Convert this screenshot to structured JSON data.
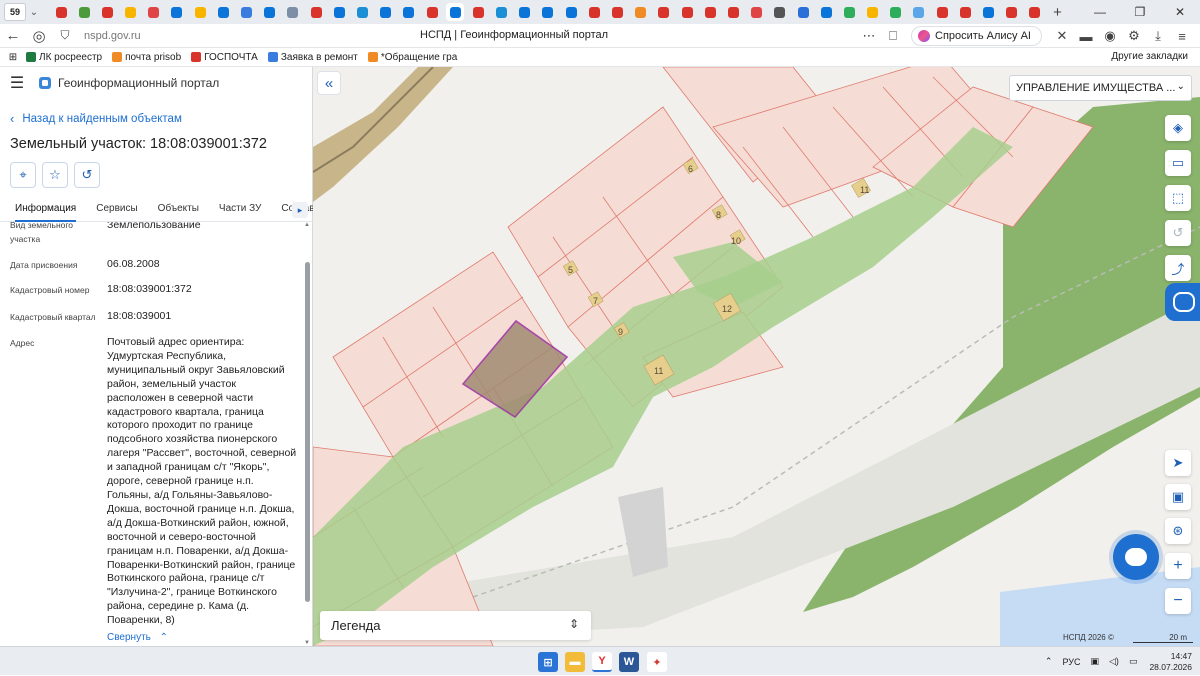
{
  "browser": {
    "tab_count": "59",
    "url": "nspd.gov.ru",
    "title": "НСПД | Геоинформационный портал",
    "alice_button": "Спросить Алису AI",
    "favicon_colors": [
      "#d9342b",
      "#4b9b3b",
      "#d9342b",
      "#f7b500",
      "#e04545",
      "#0a74d8",
      "#f7b500",
      "#0a74d8",
      "#3a7be0",
      "#0a74d8",
      "#7d8ea7",
      "#d9342b",
      "#0a74d8",
      "#1b8fd6",
      "#0a74d8",
      "#0a74d8",
      "#d9342b",
      "#0a74d8",
      "#d9342b",
      "#1b8fd6",
      "#0a74d8",
      "#0a74d8",
      "#0a74d8",
      "#d9342b",
      "#d9342b",
      "#f08a24",
      "#d9342b",
      "#d9342b",
      "#d9342b",
      "#d9342b",
      "#e04545",
      "#555555",
      "#2b6fd8",
      "#0a74d8",
      "#2eae5a",
      "#f7b500",
      "#2eae5a",
      "#5aa6e8",
      "#d9342b",
      "#d9342b",
      "#0a74d8",
      "#d9342b",
      "#d9342b"
    ],
    "bookmarks": [
      {
        "label": "ЛК росреестр",
        "color": "#1f7a3f"
      },
      {
        "label": "почта prisob",
        "color": "#f08a24"
      },
      {
        "label": "ГОСПОЧТА",
        "color": "#d9342b"
      },
      {
        "label": "Заявка в ремонт",
        "color": "#3a7be0"
      },
      {
        "label": "*Обращение гра",
        "color": "#f08a24"
      }
    ],
    "other_bookmarks": "Другие закладки"
  },
  "panel": {
    "portal_name": "Геоинформационный портал",
    "back_link": "Назад к найденным объектам",
    "object_title": "Земельный участок: 18:08:039001:372",
    "tabs": [
      "Информация",
      "Сервисы",
      "Объекты",
      "Части ЗУ",
      "Состав"
    ],
    "collapse_link": "Свернуть",
    "rows": [
      {
        "label": "Вид земельного участка",
        "value": "Землепользование"
      },
      {
        "label": "Дата присвоения",
        "value": "06.08.2008"
      },
      {
        "label": "Кадастровый номер",
        "value": "18:08:039001:372"
      },
      {
        "label": "Кадастровый квартал",
        "value": "18:08:039001"
      },
      {
        "label": "Адрес",
        "value": "Почтовый адрес ориентира: Удмуртская Республика, муниципальный округ Завьяловский район, земельный участок расположен в северной части кадастрового квартала, граница которого проходит по границе подсобного хозяйства пионерского лагеря \"Рассвет\", восточной, северной и западной границам с/т \"Якорь\", дороге, северной границе н.п. Гольяны, а/д Гольяны-Завьялово-Докша, восточной границе н.п. Докша, а/д Докша-Воткинский район, южной, восточной и северо-восточной границам н.п. Поваренки, а/д Докша-Поваренки-Воткинский район, границе Воткинского района, границе с/т \"Излучина-2\", границе Воткинского района, середине р. Кама (д. Поваренки, 8)"
      }
    ]
  },
  "map": {
    "layer_select": "УПРАВЛЕНИЕ ИМУЩЕСТВА ...",
    "legend": "Легенда",
    "attribution": "НСПД 2026 ©",
    "scale": "20 m",
    "parcel_numbers": [
      "6",
      "8",
      "10",
      "11",
      "5",
      "7",
      "9",
      "12",
      "11"
    ]
  },
  "taskbar": {
    "lang": "РУС",
    "time": "14:47",
    "date": "28.07.2026"
  }
}
